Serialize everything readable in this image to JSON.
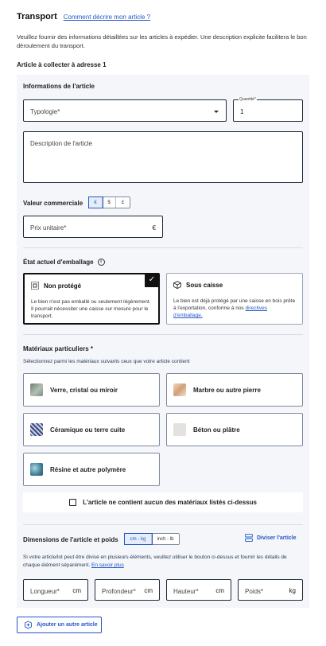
{
  "header": {
    "title": "Transport",
    "help_link": "Comment décrire mon article ?"
  },
  "intro": "Veuillez fournir des informations détaillées sur les articles à expédier. Une description explicite facilitera le bon déroulement du transport.",
  "article_label": "Article à collecter à adresse 1",
  "info": {
    "title": "Informations de l'article",
    "typology_placeholder": "Typologie*",
    "quantity_label": "Quantité*",
    "quantity_value": "1",
    "description_placeholder": "Description de l'article"
  },
  "value": {
    "title": "Valeur commerciale",
    "currencies": [
      "€",
      "$",
      "£"
    ],
    "selected_currency": "€",
    "unit_price_placeholder": "Prix unitaire*",
    "unit_price_symbol": "€"
  },
  "packaging": {
    "title": "État actuel d'emballage",
    "info_icon": "i",
    "options": [
      {
        "title": "Non protégé",
        "description": "Le bien n'est pas emballé ou seulement légèrement. Il pourrait nécessiter une caisse sur mesure pour le transport.",
        "selected": true,
        "check": "✓"
      },
      {
        "title": "Sous caisse",
        "description": "Le bien est déjà protégé par une caisse en bois prête à l'exportation, conforme à nos",
        "link": "directives d'emballage.",
        "selected": false
      }
    ]
  },
  "materials": {
    "title": "Matériaux particuliers *",
    "subtitle": "Sélectionnez parmi les matériaux suivants ceux que votre article contient",
    "items": [
      {
        "label": "Verre, cristal ou miroir",
        "color": "#8a9a8c"
      },
      {
        "label": "Marbre ou autre pierre",
        "color": "#e2c3a5"
      },
      {
        "label": "Céramique ou terre cuite",
        "color": "#4a5a8a"
      },
      {
        "label": "Béton ou plâtre",
        "color": "#e4e2df"
      },
      {
        "label": "Résine et autre polymère",
        "color": "#4f8a9e"
      }
    ],
    "none_label": "L'article ne contient aucun des matériaux listés ci-dessus"
  },
  "dimensions": {
    "title": "Dimensions de l'article et poids",
    "units": [
      "cm - kg",
      "inch - lb"
    ],
    "selected_unit": "cm - kg",
    "split_label": "Diviser l'article",
    "subtitle": "Si votre article/lot peut être divisé en plusieurs éléments, veuillez utiliser le bouton ci-dessus et fournir les détails de chaque élément séparément.",
    "learn_more": "En savoir plus",
    "fields": [
      {
        "placeholder": "Longueur*",
        "unit": "cm"
      },
      {
        "placeholder": "Profondeur*",
        "unit": "cm"
      },
      {
        "placeholder": "Hauteur*",
        "unit": "cm"
      },
      {
        "placeholder": "Poids*",
        "unit": "kg"
      }
    ]
  },
  "add_article": "Ajouter un autre article",
  "colors": {
    "accent": "#2457c5",
    "panel": "#f4f6f9",
    "border_dark": "#1e2a3a"
  }
}
